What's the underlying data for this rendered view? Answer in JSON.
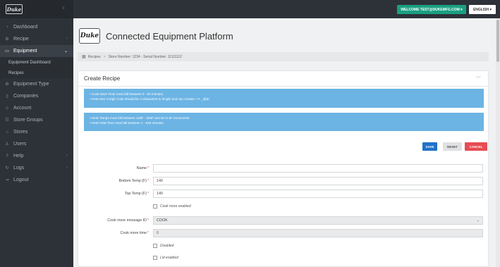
{
  "sidebar": {
    "logo_text": "Duke",
    "items": [
      {
        "label": "Dashboard",
        "icon": "dashboard-icon",
        "glyph": "◔",
        "chevron": false
      },
      {
        "label": "Recipe",
        "icon": "recipe-icon",
        "glyph": "⚙",
        "chevron": true
      },
      {
        "label": "Equipment",
        "icon": "monitor-icon",
        "glyph": "▭",
        "chevron": true,
        "active": true
      },
      {
        "label": "Equipment Type",
        "icon": "settings-icon",
        "glyph": "⚙",
        "chevron": false
      },
      {
        "label": "Companies",
        "icon": "building-icon",
        "glyph": "▯",
        "chevron": false
      },
      {
        "label": "Account",
        "icon": "user-icon",
        "glyph": "☺",
        "chevron": false
      },
      {
        "label": "Store Groups",
        "icon": "group-icon",
        "glyph": "☷",
        "chevron": false
      },
      {
        "label": "Stores",
        "icon": "store-icon",
        "glyph": "⌂",
        "chevron": false
      },
      {
        "label": "Users",
        "icon": "users-icon",
        "glyph": "♙",
        "chevron": false
      },
      {
        "label": "Help",
        "icon": "help-icon",
        "glyph": "?",
        "chevron": true
      },
      {
        "label": "Logs",
        "icon": "logs-icon",
        "glyph": "↻",
        "chevron": true
      },
      {
        "label": "Logout",
        "icon": "logout-icon",
        "glyph": "⇥",
        "chevron": false
      }
    ],
    "submenu": [
      "Equipment Dashboard",
      "Recipes"
    ]
  },
  "topbar": {
    "welcome": "WELCOME TEST@DUKEMFG.COM ▾",
    "language": "ENGLISH ▾"
  },
  "header": {
    "logo_text": "Duke",
    "title": "Connected Equipment Platform"
  },
  "breadcrumb": {
    "icon": "grid-icon",
    "root": "Recipes",
    "separator": ">",
    "path": "Store Number: 1234 - Serial Number: 11111112"
  },
  "card": {
    "title": "Create Recipe",
    "info1": [
      "Cook More Time must fall between 0 - 60 minutes",
      "Hmm Bar 4 Digit Code should be 4 characters in length and can contain:  >< _@&!"
    ],
    "info2": [
      "HHD Temps must fall between 140F - 200F and be in 5F increments",
      "HHD Hold Time must fall between 1 - 540 minutes"
    ],
    "buttons": {
      "save": "SAVE",
      "reset": "RESET",
      "cancel": "CANCEL"
    }
  },
  "form": {
    "name": {
      "label": "Name",
      "value": ""
    },
    "bottom_temp": {
      "label": "Bottom Temp (F)",
      "value": "140"
    },
    "top_temp": {
      "label": "Top Temp (F)",
      "value": "140"
    },
    "cook_more_enabled": "Cook more enabled",
    "cook_more_msg": {
      "label": "Cook more message ID",
      "value": "COOK"
    },
    "cook_more_time": {
      "label": "Cook more time",
      "value": "0"
    },
    "disabled": "Disabled",
    "lid_enabled": "Lid enabled",
    "required_mark": "*"
  },
  "colors": {
    "sidebar_bg": "#2d3238",
    "accent_green": "#1aa082",
    "info_blue": "#6cb4e4",
    "save_blue": "#1f72c9",
    "cancel_red": "#e74c53"
  }
}
